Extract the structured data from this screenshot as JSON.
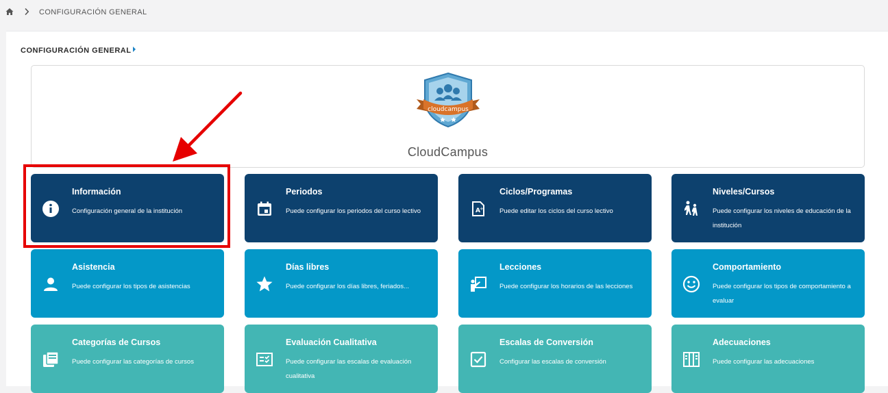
{
  "breadcrumb": {
    "current": "CONFIGURACIÓN GENERAL"
  },
  "section": {
    "title": "CONFIGURACIÓN GENERAL"
  },
  "brand": {
    "name": "CloudCampus",
    "logo_text": "cloudcampus"
  },
  "colors": {
    "dark": "#0d416e",
    "mid": "#0498c8",
    "teal": "#43b6b4",
    "highlight": "#e60000"
  },
  "tiles": [
    {
      "title": "Información",
      "desc": "Configuración general de la institución",
      "icon": "info-icon"
    },
    {
      "title": "Periodos",
      "desc": "Puede configurar los periodos del curso lectivo",
      "icon": "calendar-icon"
    },
    {
      "title": "Ciclos/Programas",
      "desc": "Puede editar los ciclos del curso lectivo",
      "icon": "grade-document-icon"
    },
    {
      "title": "Niveles/Cursos",
      "desc": "Puede configurar los niveles de educación de la institución",
      "icon": "students-walking-icon"
    },
    {
      "title": "Asistencia",
      "desc": "Puede configurar los tipos de asistencias",
      "icon": "person-icon"
    },
    {
      "title": "Días libres",
      "desc": "Puede configurar los días libres, feriados...",
      "icon": "star-icon"
    },
    {
      "title": "Lecciones",
      "desc": "Puede configurar los horarios de las lecciones",
      "icon": "teacher-board-icon"
    },
    {
      "title": "Comportamiento",
      "desc": "Puede configurar los tipos de comportamiento a evaluar",
      "icon": "smiley-icon"
    },
    {
      "title": "Categorías de Cursos",
      "desc": "Puede configurar las categorías de cursos",
      "icon": "library-books-icon"
    },
    {
      "title": "Evaluación Cualitativa",
      "desc": "Puede configurar las escalas de evaluación cualitativa",
      "icon": "checklist-icon"
    },
    {
      "title": "Escalas de Conversión",
      "desc": "Configurar las escalas de conversión",
      "icon": "checkbox-icon"
    },
    {
      "title": "Adecuaciones",
      "desc": "Puede configurar las adecuaciones",
      "icon": "books-icon"
    }
  ]
}
